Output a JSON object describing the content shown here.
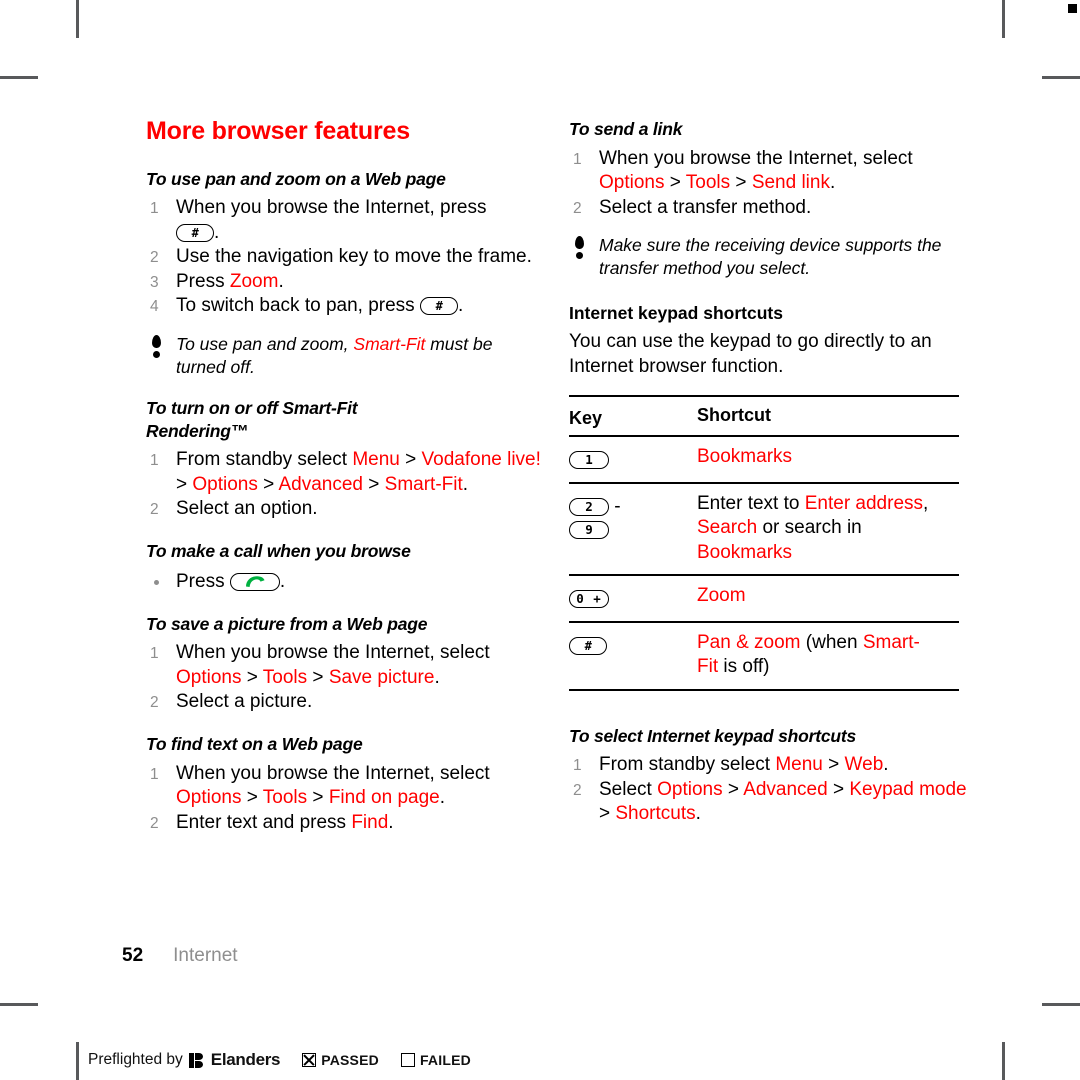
{
  "page": {
    "chapter_title": "More browser features",
    "folio_number": "52",
    "folio_section": "Internet"
  },
  "left_column": {
    "sections": [
      {
        "heading": "To use pan and zoom on a Web page",
        "steps": [
          "When you browse the Internet, press",
          "Use the navigation key to move the frame.",
          "Press Zoom.",
          "To switch back to pan, press"
        ]
      },
      {
        "note": "To use pan and zoom, Smart-Fit must be turned off.",
        "note_plain": "To use pan and zoom, ",
        "note_red": "Smart-Fit",
        "note_tail": " must be turned off."
      },
      {
        "heading": "To turn on or off Smart-Fit Rendering™",
        "steps": [
          "From standby select Menu > Vodafone live! > Options > Advanced > Smart-Fit.",
          "Select an option."
        ]
      },
      {
        "heading": "To make a call when you browse",
        "bullet": "Press"
      },
      {
        "heading": "To save a picture from a Web page",
        "steps": [
          "When you browse the Internet, select Options > Tools > Save picture.",
          "Select a picture."
        ]
      },
      {
        "heading": "To find text on a Web page",
        "steps": [
          "When you browse the Internet, select Options > Tools > Find on page.",
          "Enter text and press Find."
        ]
      }
    ],
    "tokens": {
      "zoom": "Zoom",
      "smart_fit": "Smart-Fit",
      "menu": "Menu",
      "vodafone_live": "Vodafone live!",
      "options": "Options",
      "advanced": "Advanced",
      "tools": "Tools",
      "save_picture": "Save picture",
      "find_on_page": "Find on page",
      "find": "Find"
    },
    "text": {
      "s1_l1": "When you browse the Internet, press",
      "s1_l2_period": ".",
      "s2": "Use the navigation key to move the frame.",
      "s3_pre": "Press ",
      "s3_period": ".",
      "s4_pre": "To switch back to pan, press ",
      "s4_period": ".",
      "rendering_heading_1": "To turn on or off Smart-Fit",
      "rendering_heading_2": "Rendering™",
      "r_s1_pre": "From standby select ",
      "gt": " > ",
      "r_s1_end": ".",
      "r_s2": "Select an option.",
      "call_heading": "To make a call when you browse",
      "call_press": "Press ",
      "call_period": ".",
      "save_heading": "To save a picture from a Web page",
      "save_s1_pre": "When you browse the Internet, select ",
      "save_s1_end": ".",
      "save_s2": "Select a picture.",
      "find_heading": "To find text on a Web page",
      "find_s1_pre": "When you browse the Internet, select ",
      "find_s1_end": ".",
      "find_s2_pre": "Enter text and press ",
      "find_s2_end": "."
    }
  },
  "right_column": {
    "send_link": {
      "heading": "To send a link",
      "s1_pre": "When you browse the Internet, select ",
      "options": "Options",
      "tools": "Tools",
      "send_link": "Send link",
      "gt": " > ",
      "s1_end": ".",
      "s2": "Select a transfer method.",
      "note": "Make sure the receiving device supports the transfer method you select."
    },
    "keypad_shortcuts": {
      "heading": "Internet keypad shortcuts",
      "intro": "You can use the keypad to go directly to an Internet browser function.",
      "columns": [
        "Key",
        "Shortcut"
      ],
      "rows": [
        {
          "key_glyphs": [
            "1"
          ],
          "shortcut_text": "Bookmarks"
        },
        {
          "key_glyphs": [
            "2",
            "9"
          ],
          "key_separator": "-",
          "shortcut_text": "Enter text to Enter address, Search or search in Bookmarks"
        },
        {
          "key_glyphs": [
            "0 +"
          ],
          "shortcut_text": "Zoom"
        },
        {
          "key_glyphs": [
            "#"
          ],
          "shortcut_text": "Pan & zoom (when Smart-Fit is off)"
        }
      ]
    },
    "row_parts": {
      "r1_bookmarks": "Bookmarks",
      "r2_pre": "Enter text to ",
      "r2_enter_address": "Enter address",
      "r2_comma": ",",
      "r2_search": "Search",
      "r2_mid": " or search in",
      "r2_bookmarks": "Bookmarks",
      "r2_dash": "-",
      "r3_zoom": "Zoom",
      "r4_pan": "Pan & zoom",
      "r4_when": " (when ",
      "r4_smart": "Smart-",
      "r4_fit": "Fit",
      "r4_off": " is off)"
    },
    "select_shortcuts": {
      "heading": "To select Internet keypad shortcuts",
      "s1_pre": "From standby select ",
      "menu": "Menu",
      "web": "Web",
      "gt": " > ",
      "s1_end": ".",
      "s2_pre": "Select ",
      "options": "Options",
      "advanced": "Advanced",
      "keypad_mode": "Keypad mode",
      "shortcuts": "Shortcuts",
      "s2_end": "."
    }
  },
  "footer": {
    "preflight_label": "Preflighted by",
    "brand": "Elanders",
    "passed": "PASSED",
    "failed": "FAILED"
  },
  "keys": {
    "hash_key": "#",
    "one": "1",
    "two": "2",
    "nine": "9",
    "zero_plus": "0 +"
  },
  "colors": {
    "accent_red": "#ff0000",
    "step_gray": "#8e8e8e",
    "call_green": "#00b140",
    "crop_mark": "#58595b"
  }
}
